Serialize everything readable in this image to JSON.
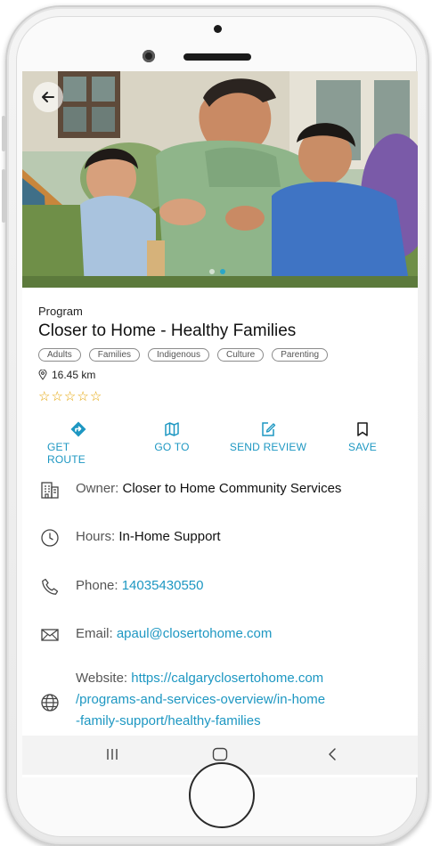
{
  "screen": {
    "category": "Program",
    "title": "Closer to Home - Healthy Families",
    "tags": [
      "Adults",
      "Families",
      "Indigenous",
      "Culture",
      "Parenting"
    ],
    "distance": "16.45 km",
    "rating": {
      "value": 0,
      "max": 5
    },
    "carousel": {
      "pages": 2,
      "active": 2
    },
    "actions": {
      "get_route": "GET ROUTE",
      "go_to": "GO TO",
      "send_review": "SEND REVIEW",
      "save": "SAVE"
    },
    "details": {
      "owner_label": "Owner: ",
      "owner_value": "Closer to Home Community Services",
      "hours_label": "Hours: ",
      "hours_value": "In-Home Support",
      "phone_label": "Phone: ",
      "phone_value": "14035430550",
      "email_label": "Email: ",
      "email_value": "apaul@closertohome.com",
      "website_label": "Website: ",
      "website_line1": "https://calgaryclosertohome.com",
      "website_line2": "/programs-and-services-overview/in-home",
      "website_line3": "-family-support/healthy-families"
    }
  },
  "colors": {
    "accent": "#1d97c2",
    "star": "#e4a300"
  },
  "icons": {
    "back": "arrow-left-icon",
    "get_route": "directions-icon",
    "go_to": "map-icon",
    "send_review": "edit-icon",
    "save": "bookmark-icon",
    "owner": "building-icon",
    "hours": "clock-icon",
    "phone": "phone-icon",
    "email": "mail-icon",
    "website": "globe-icon"
  }
}
